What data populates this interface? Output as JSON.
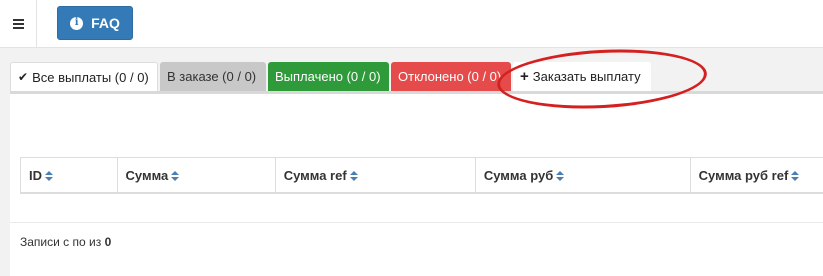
{
  "header": {
    "faq_label": "FAQ",
    "faq_icon": "info-icon",
    "menu_icon": "hamburger-icon"
  },
  "tabs": [
    {
      "label": "Все выплаты (0 / 0)",
      "icon": "check-icon",
      "color": "#ffffff"
    },
    {
      "label": "В заказе (0 / 0)",
      "color": "#c8c8c8"
    },
    {
      "label": "Выплачено (0 / 0)",
      "color": "#2e9a3a"
    },
    {
      "label": "Отклонено (0 / 0)",
      "color": "#e64b4b"
    },
    {
      "label": "Заказать выплату",
      "icon": "plus-icon",
      "color": "#ffffff"
    }
  ],
  "table": {
    "columns": [
      "ID",
      "Сумма",
      "Сумма ref",
      "Сумма руб",
      "Сумма руб ref"
    ]
  },
  "info": {
    "prefix": "Записи с по из",
    "total": "0"
  },
  "colors": {
    "primary": "#337ab7",
    "annotation": "#d42020"
  }
}
